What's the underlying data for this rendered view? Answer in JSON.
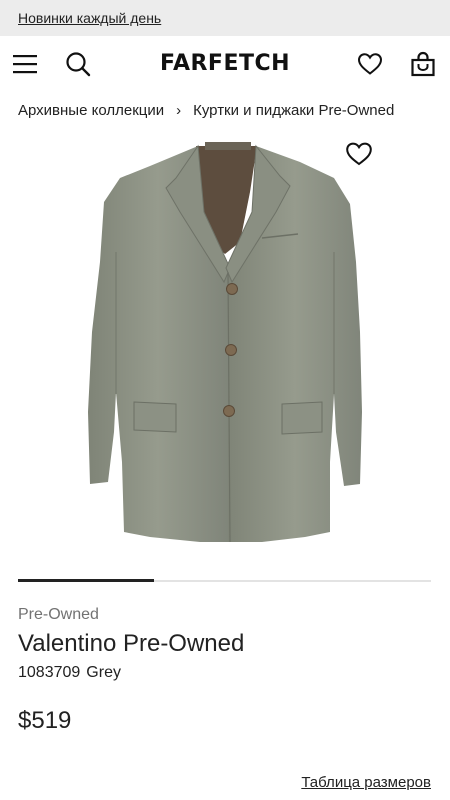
{
  "promo": {
    "text": "Новинки каждый день"
  },
  "header": {
    "logo": "FARFETCH",
    "icons": [
      "menu-icon",
      "search-icon",
      "heart-icon",
      "bag-icon"
    ]
  },
  "breadcrumb": {
    "items": [
      "Архивные коллекции",
      "Куртки и пиджаки Pre-Owned"
    ],
    "separator": "›"
  },
  "gallery": {
    "image_subject": "grey three-button blazer",
    "progress": 0.33
  },
  "product": {
    "condition": "Pre-Owned",
    "brand": "Valentino Pre-Owned",
    "sku": "1083709",
    "color": "Grey",
    "price": "$519",
    "size_guide": "Таблица размеров"
  },
  "colors": {
    "text": "#222222",
    "muted": "#727272",
    "promo_bg": "#ececec",
    "jacket": "#8e9386"
  }
}
